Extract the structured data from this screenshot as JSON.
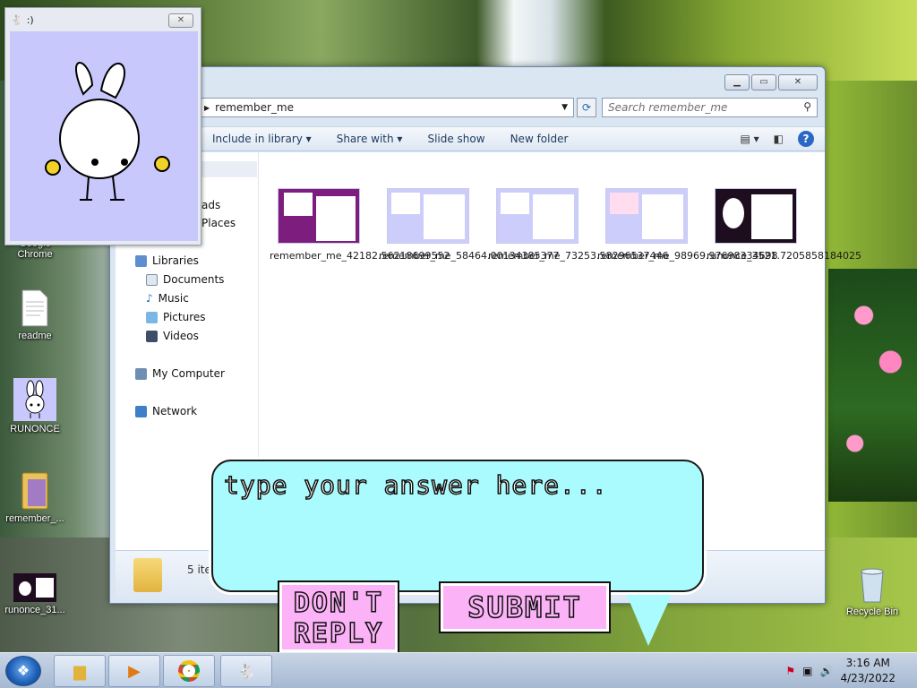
{
  "desktop": {
    "icons": [
      {
        "label": "Google Chrome"
      },
      {
        "label": "readme"
      },
      {
        "label": "RUNONCE"
      },
      {
        "label": "remember_..."
      },
      {
        "label": "runonce_31..."
      },
      {
        "label": "Recycle Bin"
      }
    ]
  },
  "bunny_window": {
    "title": ":)",
    "close_label": "✕"
  },
  "explorer": {
    "address": "remember_me",
    "search_placeholder": "Search remember_me",
    "toolbar": {
      "include_label": "Include in library",
      "share_label": "Share with",
      "slideshow_label": "Slide show",
      "newfolder_label": "New folder"
    },
    "nav": {
      "downloads_fragment": "ads",
      "places_fragment": "Places",
      "libraries": "Libraries",
      "documents": "Documents",
      "music": "Music",
      "pictures": "Pictures",
      "videos": "Videos",
      "computer": "My Computer",
      "network": "Network"
    },
    "files": [
      {
        "name": "remember_me_42182.56218699552"
      },
      {
        "name": "remember_me_58464.00134385377"
      },
      {
        "name": "remember_me_73253.58296537446"
      },
      {
        "name": "remember_me_98969.97698334698"
      },
      {
        "name": "runonce_3521.7205858184025"
      }
    ],
    "status": "5 ite"
  },
  "dialog": {
    "input_placeholder": "type your answer here...",
    "dont_reply_line1": "DON'T",
    "dont_reply_line2": "REPLY",
    "submit_label": "SUBMIT"
  },
  "taskbar": {
    "time": "3:16 AM",
    "date": "4/23/2022"
  },
  "colors": {
    "bubble": "#a9fbfd",
    "button_pink": "#fbb2f6",
    "bunny_bg": "#c8c8fd"
  }
}
